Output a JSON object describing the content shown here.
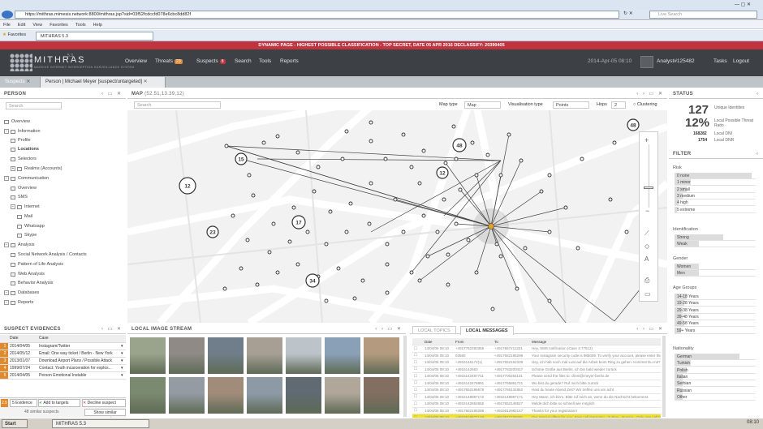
{
  "browser": {
    "url": "https://mithras.mimesis.network:8800/mithras.jsp?sid=03f52fcdccfd078e6cbc8dd82f",
    "search_placeholder": "Live Search",
    "menu": [
      "File",
      "Edit",
      "View",
      "Favorites",
      "Tools",
      "Help"
    ],
    "favorites_label": "Favorites",
    "tab_title": "MITHRAS 5.3"
  },
  "banner": "DYNAMIC PAGE - HIGHEST POSSIBLE CLASSIFICATION - TOP SECRET, DATE 05 APR 2016 DECLASSIFY: 20390405",
  "app": {
    "name": "MITHRAS",
    "version": "5.3",
    "subtitle": "MASSIVE INTERNET INTERCEPTION SURVEILLANCE SYSTEM",
    "nav": [
      "Overview",
      "Threats",
      "Suspects",
      "Search",
      "Tools",
      "Reports"
    ],
    "threats_count": "23",
    "suspects_count": "8",
    "datetime": "2014-Apr-05 08:10",
    "user": "Analyst#125482",
    "tasks": "Tasks",
    "logout": "Logout"
  },
  "subtabs": [
    "Suspects",
    "Person | Michael Meyer [suspect/untargeted]"
  ],
  "person_panel": {
    "title": "PERSON",
    "search_placeholder": "Search",
    "tree": [
      "Overview",
      "Information",
      "Profile",
      "Locations",
      "Selectors",
      "Realms (Accounts)",
      "Communication",
      "Overview",
      "SMS",
      "Internet",
      "Mail",
      "Whatsapp",
      "Skype",
      "Analysis",
      "Social Network Analysis / Contacts",
      "Pattern of Life Analysis",
      "Web Analysis",
      "Behavior Analysis",
      "Databases",
      "Reports"
    ]
  },
  "map": {
    "title": "MAP",
    "coords": "(52.51,13.39,12)",
    "search_placeholder": "Search",
    "map_type_label": "Map type",
    "map_type": "Map",
    "vis_label": "Visualisation type",
    "vis": "Points",
    "hops_label": "Hops",
    "hops": "2",
    "clustering": "Clustering",
    "clusters": [
      "15",
      "48",
      "12",
      "48",
      "12",
      "17",
      "23",
      "34"
    ]
  },
  "status": {
    "title": "STATUS",
    "unique": "127",
    "unique_label": "Unique Identities",
    "local_pct": "12%",
    "local_label": "Local Possible Threat Ratio",
    "n1": "168282",
    "n1_label": "Local DNI",
    "n2": "1754",
    "n2_label": "Local DNR"
  },
  "filter": {
    "title": "FILTER",
    "risk_label": "Risk",
    "risk": [
      "0 none",
      "1 minor",
      "2 small",
      "3 medium",
      "4 high",
      "5 extreme"
    ],
    "ident_label": "Identification",
    "ident": [
      "Strong",
      "Weak"
    ],
    "gender_label": "Gender",
    "gender": [
      "Women",
      "Men"
    ],
    "age_label": "Age Groups",
    "age": [
      "14-18 Years",
      "19-28 Years",
      "29-38 Years",
      "39-48 Years",
      "49-58 Years",
      "59+ Years"
    ],
    "nat_label": "Nationality",
    "nat": [
      "German",
      "Turkish",
      "Polish",
      "Italian",
      "Serbian",
      "Russian",
      "Other"
    ]
  },
  "evidences": {
    "title": "SUSPECT EVIDENCES",
    "cols": [
      "Date",
      "Case"
    ],
    "rows": [
      [
        "2014/04/05",
        "Instagram/Twitter"
      ],
      [
        "2014/05/12",
        "Email: One way ticket / Berlin - New York"
      ],
      [
        "2013/01/07",
        "Download Airport Plans / Possible Attack"
      ],
      [
        "1999/07/24",
        "Contact: Youth incarceration for explos..."
      ],
      [
        "2014/04/05",
        "Person Emotional Instable"
      ]
    ],
    "count": "2.5",
    "btn_evidence": "5 Evidence",
    "btn_add": "Add to targets",
    "btn_decline": "Decline suspect",
    "similar": "48 similar suspects",
    "show_similar": "Show similar suspects"
  },
  "images": {
    "title": "LOCAL IMAGE STREAM"
  },
  "messages": {
    "tabs": [
      "LOCAL TOPICS",
      "LOCAL MESSAGES"
    ],
    "cols": [
      "Date",
      "From",
      "To",
      "Message"
    ],
    "rows": [
      [
        "14/04/05 08:10",
        "+4917762283365",
        "+4917667211221",
        "Hey, SMS notification (Case 4:77512)"
      ],
      [
        "14/04/05 08:10",
        "03580",
        "+4917662195298",
        "Your Instagram security code is 985009. To verify your account, please enter this code on Instagram"
      ],
      [
        "14/04/05 08:10",
        "+4915146172(1)",
        "+4917652162338",
        "Hey, ich hab noch mal Lust auf die Arbeit beim Ring zu gehen. Kommst Du mit?"
      ],
      [
        "14/04/05 08:10",
        "+4915142653",
        "+4917763200417",
        "Schöne Grüße aus Berlin, ich bin bald wieder zurück"
      ],
      [
        "14/04/05 08:10",
        "+4915142487711",
        "+4917700251131",
        "Please send the files to: client@meyer-berlin.de"
      ],
      [
        "14/04/05 08:10",
        "+4915142476891",
        "+4917765861721",
        "Wo bist du gerade? Ruf mich bitte zurück"
      ],
      [
        "14/04/05 08:10",
        "+4917652196678",
        "+4917765131862",
        "Hast du heute Abend Zeit? Wir treffen uns um acht"
      ],
      [
        "14/04/05 08:10",
        "+4915148887172",
        "+4915148887171",
        "Hey Mann, ich bin's. Bitte ruf mich an, wenn du die Nachricht bekommst."
      ],
      [
        "14/04/05 08:10",
        "+4915142652655",
        "+4917652148527",
        "Melde dich bitte so schnell wie möglich"
      ],
      [
        "14/04/05 08:10",
        "+4917662195298",
        "+4915612982147",
        "Thanks for your registration!"
      ],
      [
        "14/04/05 08:10",
        "+4915618572149",
        "+4917622108291",
        "Our special offers for you: Free call Germany - Turkey - Russia - Only one call for you!"
      ],
      [
        "14/04/05 08:10",
        "+4917765131862",
        "+4915142652655",
        "Treffpunkt morgen wie besprochen"
      ]
    ]
  },
  "taskbar": {
    "start": "Start",
    "task1": "MITHRAS 5.3",
    "clock": "08:10"
  }
}
